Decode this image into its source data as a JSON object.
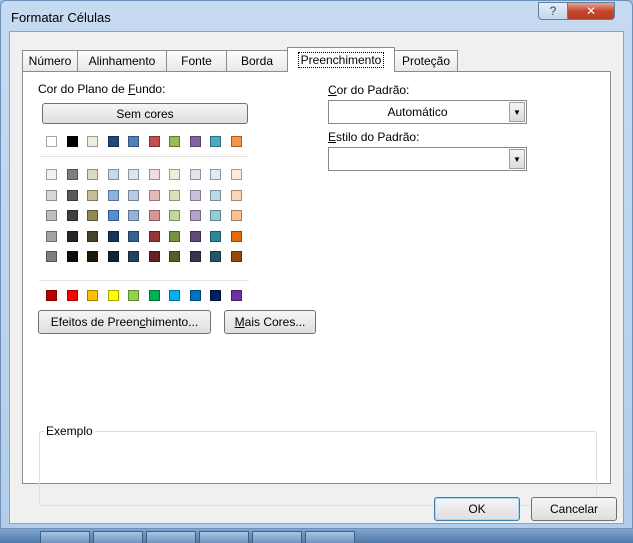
{
  "window": {
    "title": "Formatar Células"
  },
  "titlebar": {
    "help_glyph": "?",
    "close_glyph": "✕"
  },
  "tabs": [
    {
      "label": "Número",
      "active": false
    },
    {
      "label": "Alinhamento",
      "active": false
    },
    {
      "label": "Fonte",
      "active": false
    },
    {
      "label": "Borda",
      "active": false
    },
    {
      "label": "Preenchimento",
      "active": true
    },
    {
      "label": "Proteção",
      "active": false
    }
  ],
  "fill": {
    "background_label_pre": "Cor do Plano de ",
    "background_label_accel": "F",
    "background_label_post": "undo:",
    "no_color_button": "Sem cores",
    "theme_row": [
      "#ffffff",
      "#000000",
      "#eeece1",
      "#1f497d",
      "#4f81bd",
      "#c0504d",
      "#9bbb59",
      "#8064a2",
      "#4bacc6",
      "#f79646"
    ],
    "shade_rows": [
      [
        "#f2f2f2",
        "#7f7f7f",
        "#ddd9c3",
        "#c6d9f0",
        "#dbe5f1",
        "#f2dcdb",
        "#ebf1dd",
        "#e5e0ec",
        "#dbeef3",
        "#fdeada"
      ],
      [
        "#d8d8d8",
        "#595959",
        "#c4bd97",
        "#8db3e2",
        "#b8cce4",
        "#e5b9b7",
        "#d7e3bc",
        "#ccc1d9",
        "#b7dde8",
        "#fbd5b5"
      ],
      [
        "#bfbfbf",
        "#3f3f3f",
        "#938953",
        "#548dd4",
        "#95b3d7",
        "#d99694",
        "#c3d69b",
        "#b2a2c7",
        "#92cddc",
        "#fac08f"
      ],
      [
        "#a5a5a5",
        "#262626",
        "#494429",
        "#17365d",
        "#366092",
        "#953734",
        "#76923c",
        "#5f497a",
        "#31859b",
        "#e36c09"
      ],
      [
        "#7f7f7f",
        "#0c0c0c",
        "#1d1b10",
        "#0f243e",
        "#244061",
        "#632423",
        "#4f6128",
        "#3f3151",
        "#205867",
        "#974806"
      ]
    ],
    "standard_row": [
      "#c00000",
      "#ff0000",
      "#ffc000",
      "#ffff00",
      "#92d050",
      "#00b050",
      "#00b0f0",
      "#0070c0",
      "#002060",
      "#7030a0"
    ],
    "fill_effects_pre": "Efeitos de Preen",
    "fill_effects_accel": "c",
    "fill_effects_post": "himento...",
    "more_colors_accel": "M",
    "more_colors_post": "ais Cores...",
    "pattern_color_accel": "C",
    "pattern_color_post": "or do Padrão:",
    "pattern_color_value": "Automático",
    "pattern_style_accel": "E",
    "pattern_style_post": "stilo do Padrão:",
    "pattern_style_value": "",
    "sample_label": "Exemplo"
  },
  "footer": {
    "ok": "OK",
    "cancel": "Cancelar"
  },
  "icons": {
    "dropdown": "chevron-down-icon",
    "help": "help-icon",
    "close": "close-icon"
  }
}
